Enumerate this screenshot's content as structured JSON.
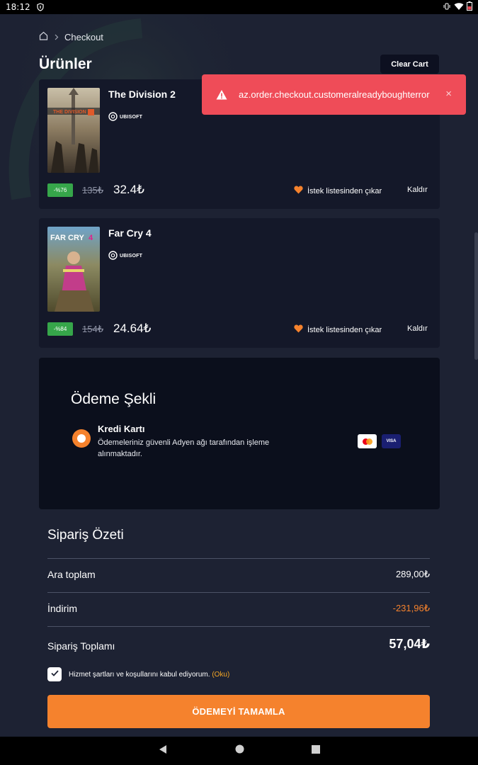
{
  "status": {
    "time": "18:12"
  },
  "breadcrumb": {
    "current": "Checkout"
  },
  "cart": {
    "title": "Ürünler",
    "clear_label": "Clear Cart",
    "items": [
      {
        "name": "The Division 2",
        "brand": "UBISOFT",
        "discount": "-%76",
        "old_price": "135₺",
        "new_price": "32.4₺",
        "wishlist_label": "İstek listesinden çıkar",
        "remove_label": "Kaldır"
      },
      {
        "name": "Far Cry 4",
        "brand": "UBISOFT",
        "discount": "-%84",
        "old_price": "154₺",
        "new_price": "24.64₺",
        "wishlist_label": "İstek listesinden çıkar",
        "remove_label": "Kaldır"
      }
    ]
  },
  "toast": {
    "message": "az.order.checkout.customeralreadyboughterror",
    "close": "×",
    "color": "#ef4c58"
  },
  "payment": {
    "title": "Ödeme Şekli",
    "method_label": "Kredi Kartı",
    "method_desc": "Ödemeleriniz güvenli Adyen ağı tarafından işleme alınmaktadır.",
    "card_icons": [
      "mastercard-icon",
      "visa-icon"
    ],
    "visa_text": "VISA"
  },
  "summary": {
    "title": "Sipariş Özeti",
    "subtotal_label": "Ara toplam",
    "subtotal_value": "289,00₺",
    "discount_label": "İndirim",
    "discount_value": "-231,96₺",
    "total_label": "Sipariş Toplamı",
    "total_value": "57,04₺"
  },
  "terms": {
    "text": "Hizmet şartları ve koşullarını kabul ediyorum.",
    "link": "(Oku)",
    "checked": true
  },
  "pay_button": {
    "label": "ÖDEMEYİ TAMAMLA"
  },
  "colors": {
    "accent": "#f5822d",
    "discount_badge": "#36a64a",
    "background": "#1d2233",
    "card": "#141829"
  }
}
